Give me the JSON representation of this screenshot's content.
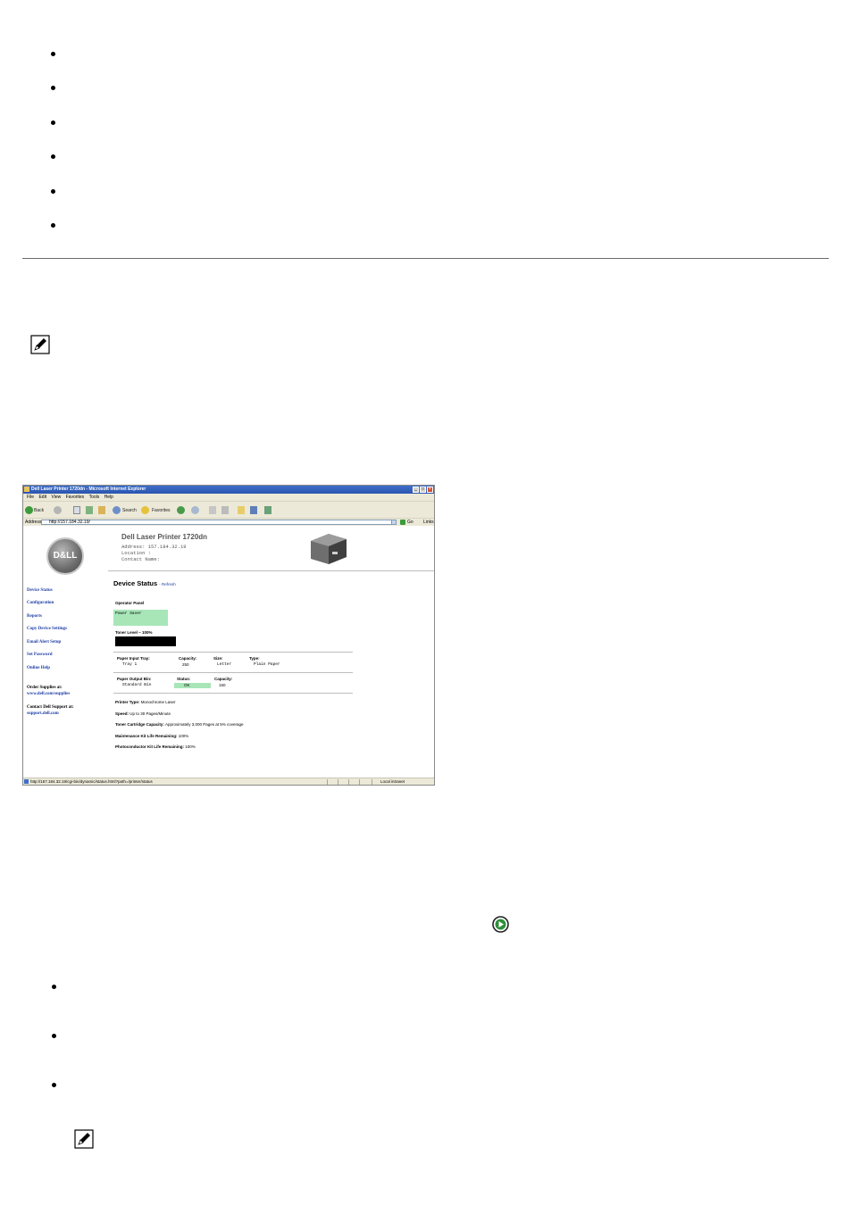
{
  "screenshot": {
    "window_title": "Dell Laser Printer 1720dn - Microsoft Internet Explorer",
    "menu": [
      "File",
      "Edit",
      "View",
      "Favorites",
      "Tools",
      "Help"
    ],
    "toolbar": {
      "back": "Back",
      "search": "Search",
      "favorites": "Favorites"
    },
    "address_label": "Address",
    "address_url": "http://157.184.32.19/",
    "go_label": "Go",
    "links_label": "Links",
    "logo_text": "D&LL",
    "header": {
      "title": "Dell Laser Printer 1720dn",
      "address": "Address: 157.184.32.19",
      "location": "Location :",
      "contact": "Contact Name:"
    },
    "nav": [
      "Device Status",
      "Configuration",
      "Reports",
      "Copy Device Settings",
      "Email Alert Setup",
      "Set Password",
      "Online Help"
    ],
    "order_supplies": {
      "label": "Order Supplies at:",
      "link": "www.dell.com/supplies"
    },
    "contact_support": {
      "label": "Contact Dell Support at:",
      "link": "support.dell.com"
    },
    "section": {
      "title": "Device Status",
      "subtitle": "- Refresh"
    },
    "operator_panel": {
      "label": "Operator Panel",
      "text": "Power Saver"
    },
    "toner": {
      "label": "Toner Level ~ 100%",
      "level": 1.0
    },
    "input_tray": {
      "headers": [
        "Paper Input Tray:",
        "Capacity:",
        "Size:",
        "Type:"
      ],
      "values": [
        "Tray 1",
        "250",
        "Letter",
        "Plain Paper"
      ]
    },
    "output_bin": {
      "headers": [
        "Paper Output Bin:",
        "Status:",
        "Capacity:"
      ],
      "values": [
        "Standard Bin",
        "OK",
        "150"
      ]
    },
    "specs": [
      {
        "label": "Printer Type:",
        "value": "Monochrome Laser"
      },
      {
        "label": "Speed:",
        "value": "Up to 30 Pages/Minute"
      },
      {
        "label": "Toner Cartridge Capacity:",
        "value": "Approximately 3,000 Pages at 5% coverage"
      },
      {
        "label": "Maintenance Kit Life Remaining:",
        "value": "100%"
      },
      {
        "label": "Photoconductor Kit Life Remaining:",
        "value": "100%"
      }
    ],
    "status_url": "http://157.184.32.19/cgi-bin/dynamic/status.html?path=/printer/status",
    "status_zone": "Local intranet"
  },
  "icons": {
    "note": "pencil-note-icon",
    "go": "play-arrow-icon"
  }
}
